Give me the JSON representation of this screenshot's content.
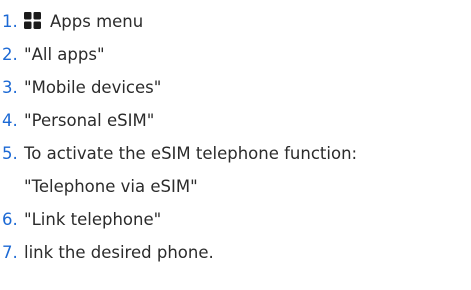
{
  "steps": [
    {
      "number": "1.",
      "icon": "apps-grid-icon",
      "text": "Apps menu"
    },
    {
      "number": "2.",
      "text": "\"All apps\""
    },
    {
      "number": "3.",
      "text": "\"Mobile devices\""
    },
    {
      "number": "4.",
      "text": "\"Personal eSIM\""
    },
    {
      "number": "5.",
      "text": "To activate the eSIM telephone function:",
      "text2": "\"Telephone via eSIM\""
    },
    {
      "number": "6.",
      "text": "\"Link telephone\""
    },
    {
      "number": "7.",
      "text": "link the desired phone."
    }
  ]
}
